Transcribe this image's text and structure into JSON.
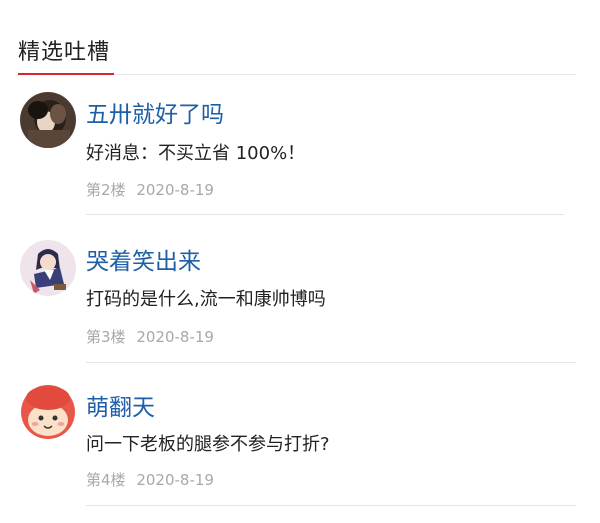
{
  "section": {
    "title": "精选吐槽"
  },
  "colors": {
    "accent": "#d8242a",
    "username": "#1e5fa8",
    "meta": "#a8a8a8"
  },
  "comments": [
    {
      "username": "五卅就好了吗",
      "content": "好消息：不买立省 100%！",
      "floor": "第2楼",
      "date": "2020-8-19",
      "avatar_icon": "avatar-dark-photo-icon"
    },
    {
      "username": "哭着笑出来",
      "content": "打码的是什么,流一和康帅博吗",
      "floor": "第3楼",
      "date": "2020-8-19",
      "avatar_icon": "avatar-anime-girl-icon"
    },
    {
      "username": "萌翻天",
      "content": "问一下老板的腿参不参与打折?",
      "floor": "第4楼",
      "date": "2020-8-19",
      "avatar_icon": "avatar-cartoon-red-hat-icon"
    }
  ]
}
